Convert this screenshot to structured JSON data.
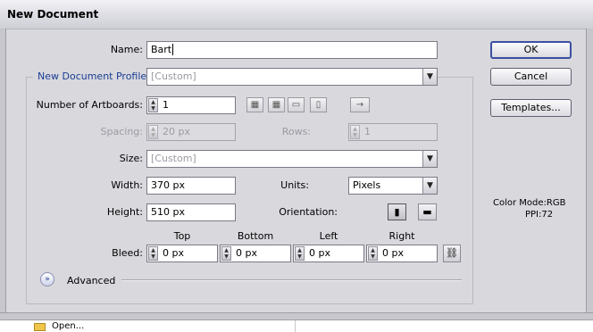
{
  "window": {
    "title": "New Document"
  },
  "form": {
    "name_label": "Name:",
    "name_value": "Bart",
    "profile_label": "New Document Profile:",
    "profile_value": "[Custom]",
    "artboards_label": "Number of Artboards:",
    "artboards_value": "1",
    "spacing_label": "Spacing:",
    "spacing_value": "20 px",
    "rows_label": "Rows:",
    "rows_value": "1",
    "size_label": "Size:",
    "size_value": "[Custom]",
    "width_label": "Width:",
    "width_value": "370 px",
    "height_label": "Height:",
    "height_value": "510 px",
    "units_label": "Units:",
    "units_value": "Pixels",
    "orientation_label": "Orientation:",
    "bleed_label": "Bleed:",
    "bleed": {
      "top_label": "Top",
      "top_value": "0 px",
      "bottom_label": "Bottom",
      "bottom_value": "0 px",
      "left_label": "Left",
      "left_value": "0 px",
      "right_label": "Right",
      "right_value": "0 px"
    },
    "advanced_label": "Advanced"
  },
  "buttons": {
    "ok": "OK",
    "cancel": "Cancel",
    "templates": "Templates..."
  },
  "info": {
    "color_mode": "Color Mode:RGB",
    "ppi": "PPI:72"
  },
  "footer": {
    "open_label": "Open..."
  },
  "icons": {
    "arrange": [
      "grid-by-row-icon",
      "grid-by-column-icon",
      "arrange-by-row-icon",
      "arrange-by-column-icon",
      "right-to-left-icon"
    ],
    "orientation": [
      "portrait-icon",
      "landscape-icon"
    ],
    "bleed_link": "chain-link-icon",
    "advanced": "chevron-double-down-icon"
  },
  "colors": {
    "profile_label": "#1a3d94",
    "ok_border": "#3c4fa0"
  }
}
